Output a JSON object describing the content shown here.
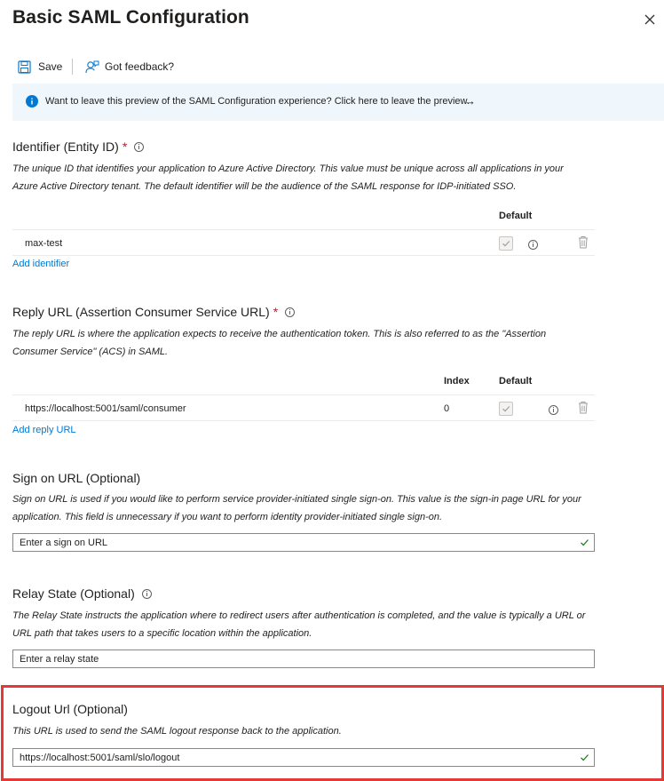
{
  "panel": {
    "title": "Basic SAML Configuration"
  },
  "toolbar": {
    "save_label": "Save",
    "feedback_label": "Got feedback?"
  },
  "banner": {
    "text": "Want to leave this preview of the SAML Configuration experience? Click here to leave the preview.",
    "arrow": "→"
  },
  "identifier": {
    "title": "Identifier (Entity ID)",
    "required_mark": "*",
    "description": "The unique ID that identifies your application to Azure Active Directory. This value must be unique across all applications in your Azure Active Directory tenant. The default identifier will be the audience of the SAML response for IDP-initiated SSO.",
    "col_default": "Default",
    "rows": [
      {
        "value": "max-test",
        "default": true
      }
    ],
    "add_link": "Add identifier"
  },
  "reply_url": {
    "title": "Reply URL (Assertion Consumer Service URL)",
    "required_mark": "*",
    "description": "The reply URL is where the application expects to receive the authentication token. This is also referred to as the \"Assertion Consumer Service\" (ACS) in SAML.",
    "col_index": "Index",
    "col_default": "Default",
    "rows": [
      {
        "value": "https://localhost:5001/saml/consumer",
        "index": "0",
        "default": true
      }
    ],
    "add_link": "Add reply URL"
  },
  "sign_on": {
    "title": "Sign on URL (Optional)",
    "description": "Sign on URL is used if you would like to perform service provider-initiated single sign-on. This value is the sign-in page URL for your application. This field is unnecessary if you want to perform identity provider-initiated single sign-on.",
    "placeholder": "Enter a sign on URL",
    "value": ""
  },
  "relay_state": {
    "title": "Relay State (Optional)",
    "description": "The Relay State instructs the application where to redirect users after authentication is completed, and the value is typically a URL or URL path that takes users to a specific location within the application.",
    "placeholder": "Enter a relay state",
    "value": ""
  },
  "logout": {
    "title": "Logout Url (Optional)",
    "description": "This URL is used to send the SAML logout response back to the application.",
    "placeholder": "",
    "value": "https://localhost:5001/saml/slo/logout"
  },
  "colors": {
    "accent": "#0078d4",
    "required": "#a4262c",
    "highlight": "#e53935",
    "banner_bg": "#eff6fc",
    "valid": "#107c10"
  }
}
